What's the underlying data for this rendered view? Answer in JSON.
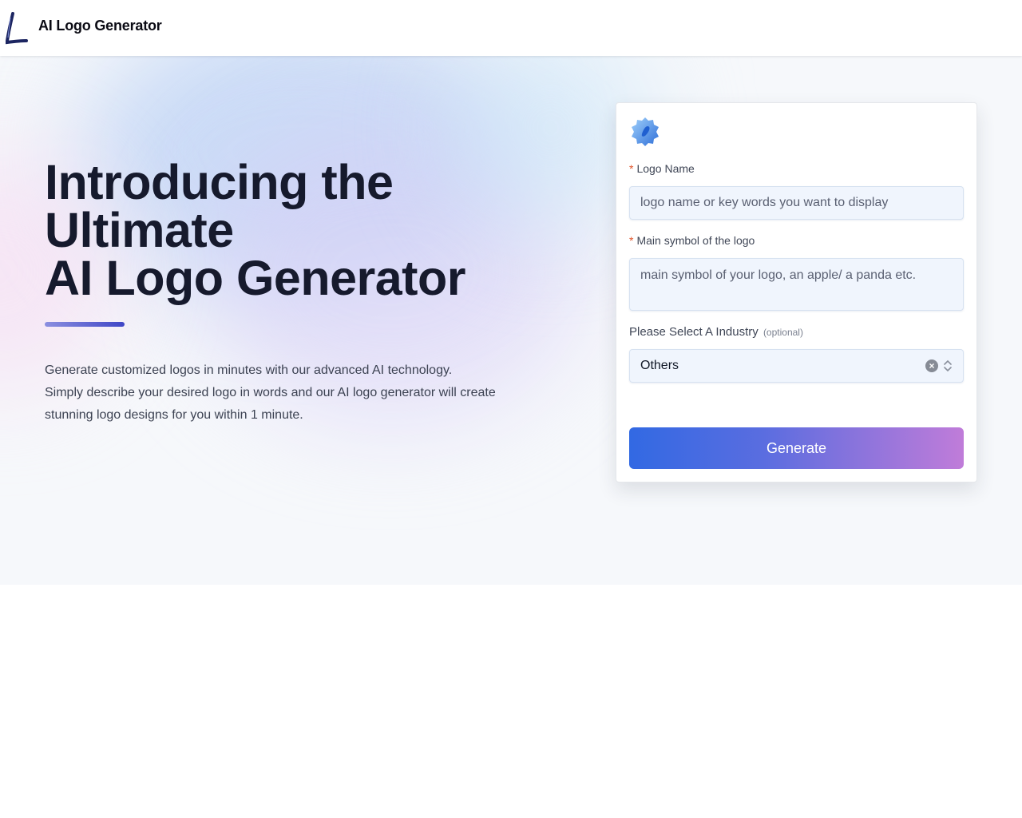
{
  "header": {
    "brand_logo_icon": "letter-l-logo",
    "title": "AI Logo Generator"
  },
  "hero": {
    "headline_lines": [
      "Introducing the",
      "Ultimate",
      "AI Logo Generator"
    ],
    "description_lines": [
      "Generate customized logos in minutes with our advanced AI technology.",
      "Simply describe your desired logo in words and our AI logo generator will create",
      "stunning logo designs for you within 1 minute."
    ]
  },
  "form": {
    "card_icon": "blue-gear-badge-icon",
    "logo_name": {
      "required_mark": "*",
      "label": "Logo Name",
      "value": "",
      "placeholder": "logo name or key words you want to display"
    },
    "main_symbol": {
      "required_mark": "*",
      "label": "Main symbol of the logo",
      "value": "",
      "placeholder": "main symbol of your logo, an apple/ a panda etc."
    },
    "industry": {
      "label": "Please Select A Industry",
      "optional_note": "(optional)",
      "selected": "Others",
      "clear_icon": "×"
    },
    "generate_label": "Generate"
  },
  "colors": {
    "headline": "#161a2d",
    "required": "#e0542a",
    "button_gradient_start": "#3269e3",
    "button_gradient_end": "#c07cd9",
    "field_bg": "#f0f5fd"
  }
}
